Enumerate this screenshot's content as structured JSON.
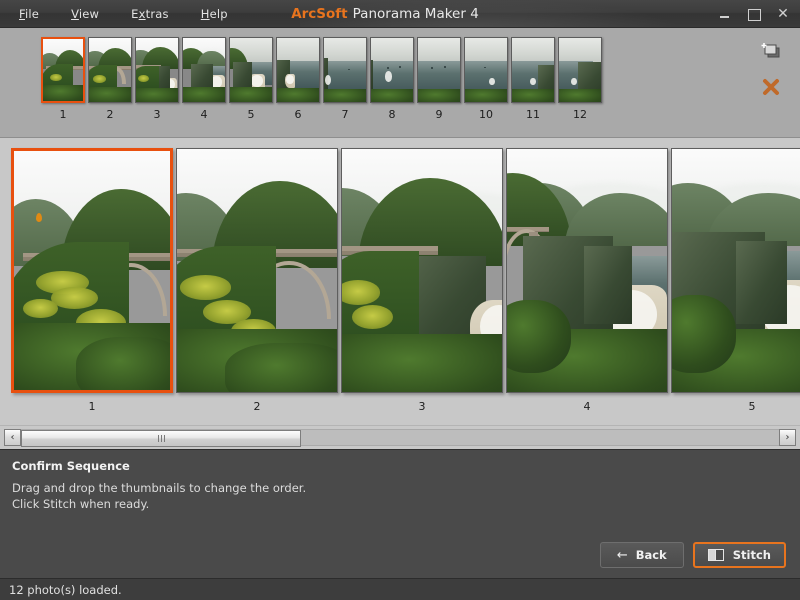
{
  "window": {
    "brand": "ArcSoft",
    "title": "Panorama Maker 4",
    "controls": {
      "minimize": "minimize-button",
      "maximize": "maximize-button",
      "close": "close-button"
    }
  },
  "menubar": {
    "items": [
      {
        "label": "File",
        "accel": "F"
      },
      {
        "label": "View",
        "accel": "V"
      },
      {
        "label": "Extras",
        "accel": "x"
      },
      {
        "label": "Help",
        "accel": "H"
      }
    ]
  },
  "thumbnail_strip": {
    "selected_index": 1,
    "thumbnails": [
      {
        "num": "1",
        "scene": "bridge"
      },
      {
        "num": "2",
        "scene": "bridge"
      },
      {
        "num": "3",
        "scene": "bridge-coast"
      },
      {
        "num": "4",
        "scene": "coast"
      },
      {
        "num": "5",
        "scene": "coast"
      },
      {
        "num": "6",
        "scene": "coast-sea"
      },
      {
        "num": "7",
        "scene": "sea"
      },
      {
        "num": "8",
        "scene": "sea"
      },
      {
        "num": "9",
        "scene": "sea"
      },
      {
        "num": "10",
        "scene": "sea"
      },
      {
        "num": "11",
        "scene": "sea-cliff"
      },
      {
        "num": "12",
        "scene": "sea-cliff"
      }
    ],
    "tools": [
      {
        "name": "add-photos-icon",
        "title": "Add photos"
      },
      {
        "name": "remove-photo-icon",
        "title": "Remove photo"
      }
    ]
  },
  "preview": {
    "selected_index": 1,
    "photos": [
      {
        "num": "1",
        "scene": "bridge"
      },
      {
        "num": "2",
        "scene": "bridge"
      },
      {
        "num": "3",
        "scene": "bridge-coast"
      },
      {
        "num": "4",
        "scene": "coast"
      },
      {
        "num": "5",
        "scene": "coast"
      }
    ]
  },
  "scrollbar": {
    "left_arrow": "‹",
    "right_arrow": "›",
    "thumb_left_pct": 0,
    "thumb_width_pct": 37
  },
  "instructions": {
    "heading": "Confirm Sequence",
    "line1": "Drag and drop the thumbnails to change the order.",
    "line2": "Click Stitch when ready."
  },
  "actions": {
    "back_label": "Back",
    "back_arrow": "←",
    "stitch_label": "Stitch"
  },
  "statusbar": {
    "message": "12 photo(s) loaded."
  },
  "colors": {
    "brand_orange": "#e8741e",
    "selection_orange": "#e8500f",
    "titlebar": "#3a3a3a",
    "strip_bg": "#a9a9a9",
    "preview_bg": "#c8c8c8",
    "panel_bg": "#4a4a4a",
    "status_bg": "#3d3d3d"
  }
}
